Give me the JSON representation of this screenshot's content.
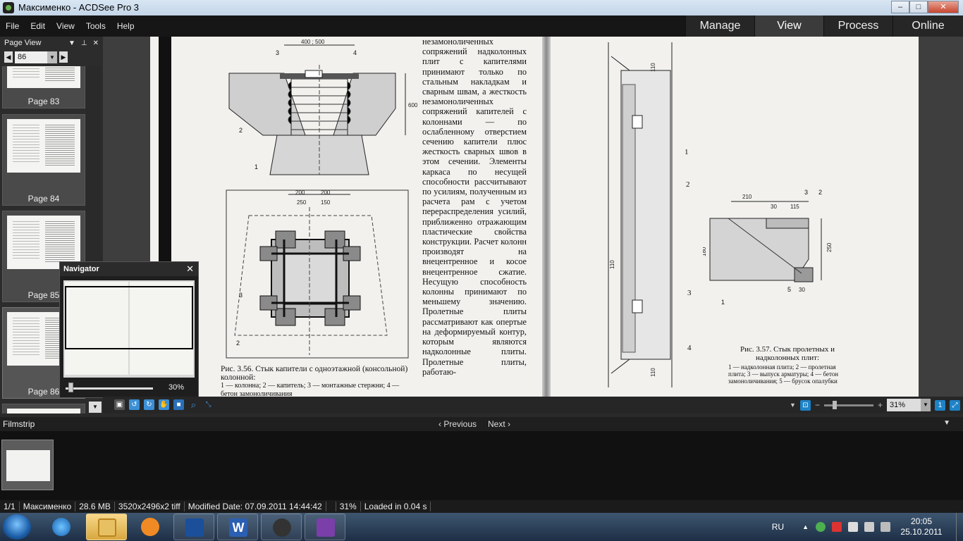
{
  "window": {
    "title": "Максименко - ACDSee Pro 3",
    "controls": [
      "–",
      "□",
      "✕"
    ]
  },
  "menu": {
    "items": [
      "File",
      "Edit",
      "View",
      "Tools",
      "Help"
    ]
  },
  "modes": [
    {
      "label": "Manage",
      "active": false
    },
    {
      "label": "View",
      "active": true
    },
    {
      "label": "Process",
      "active": false
    },
    {
      "label": "Online",
      "active": false
    }
  ],
  "page_view": {
    "title": "Page View",
    "current_page": "86",
    "thumbnails": [
      {
        "label": "Page 83"
      },
      {
        "label": "Page 84"
      },
      {
        "label": "Page 85"
      },
      {
        "label": "Page 86"
      }
    ]
  },
  "navigator": {
    "title": "Navigator",
    "zoom": "30%",
    "zoom_level": 0.3
  },
  "document": {
    "text": "незамоноличенных сопряжений надколонных плит с капителями принимают только по стальным накладкам и сварным швам, а жесткость незамоноличенных сопряжений капителей с колоннами — по ослабленному отверстием сечению капители плюс жесткость сварных швов в этом сечении. Элементы каркаса по несущей способности рассчитывают по усилиям, полученным из расчета рам с учетом перераспределения усилий, приближенно отражающим пластические свойства конструкции. Расчет колонн производят на внецентренное и косое внецентренное сжатие. Несущую способность колонны принимают по меньшему значению. Пролетные плиты рассматривают как опертые на деформируемый контур, которым являются надколонные плиты. Пролетные плиты, работаю-",
    "fig356_caption": "Рис. 3.56. Стык капители с одноэтажной (консольной) колонной:",
    "fig356_legend": "1 — колонна; 2 — капитель; 3 — монтажные стержни; 4 — бетон замоноличивания",
    "fig357_caption": "Рис. 3.57. Стык пролетных и надколонных плит:",
    "fig357_legend": "1 — надколонная плита; 2 — пролетная плита; 3 — выпуск арматуры; 4 — бетон замоноличивания; 5 — брусок опалубки",
    "dims": {
      "d1": "400 ; 500",
      "d2": "600",
      "d3": "200",
      "d4": "200",
      "d5": "250",
      "d6": "150",
      "d7": "210",
      "d8": "30",
      "d9": "115",
      "d10": "180",
      "d11": "250",
      "d12": "110",
      "d13": "30",
      "d14": "110",
      "d15": "110"
    },
    "marks": {
      "m1": "1",
      "m2": "2",
      "m3": "3",
      "m4": "4",
      "m5": "5"
    }
  },
  "viewer_toolbar": {
    "zoom": "31%"
  },
  "filmstrip": {
    "title": "Filmstrip",
    "previous": "‹ Previous",
    "next": "Next ›"
  },
  "status": {
    "index": "1/1",
    "name": "Максименко",
    "size": "28.6 MB",
    "dimensions": "3520x2496x2 tiff",
    "modified": "Modified Date: 07.09.2011 14:44:42",
    "zoom": "31%",
    "loaded": "Loaded in 0.04 s"
  },
  "taskbar": {
    "lang": "RU",
    "time": "20:05",
    "date": "25.10.2011"
  },
  "colors": {
    "accent": "#3b8fd6",
    "menubar": "#161616",
    "panel": "#2c2c2c"
  }
}
